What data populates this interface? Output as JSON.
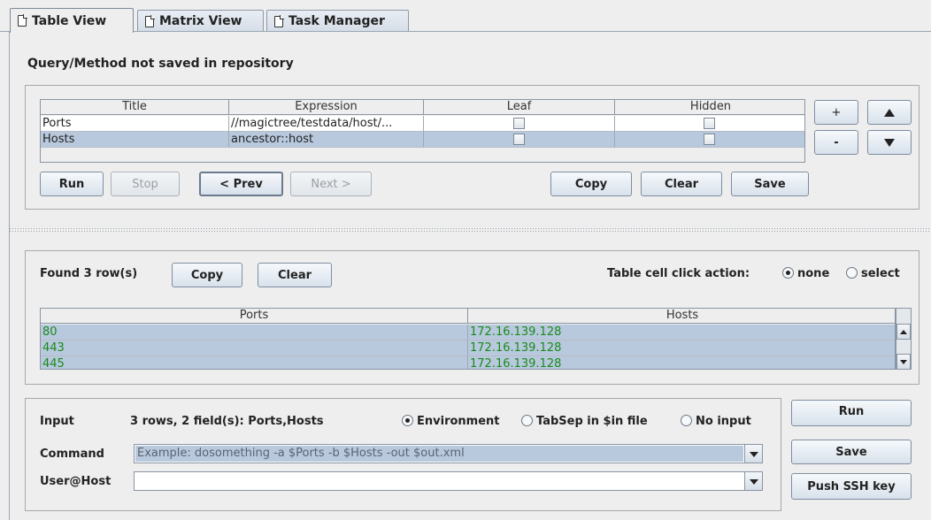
{
  "tabs": [
    {
      "label": "Table View",
      "active": true
    },
    {
      "label": "Matrix View",
      "active": false
    },
    {
      "label": "Task Manager",
      "active": false
    }
  ],
  "query": {
    "status": "Query/Method not saved in repository",
    "columns": [
      "Title",
      "Expression",
      "Leaf",
      "Hidden"
    ],
    "rows": [
      {
        "title": "Ports",
        "expression": "//magictree/testdata/host/...",
        "leaf": false,
        "hidden": false
      },
      {
        "title": "Hosts",
        "expression": "ancestor::host",
        "leaf": false,
        "hidden": false
      }
    ],
    "buttons": {
      "run": "Run",
      "stop": "Stop",
      "prev": "< Prev",
      "next": "Next >",
      "copy": "Copy",
      "clear": "Clear",
      "save": "Save",
      "add": "+",
      "remove": "-"
    }
  },
  "results": {
    "found": "Found 3 row(s)",
    "copy": "Copy",
    "clear": "Clear",
    "click_action_label": "Table cell click action:",
    "click_options": [
      "none",
      "select"
    ],
    "click_selected": "none",
    "columns": [
      "Ports",
      "Hosts"
    ],
    "rows": [
      [
        "80",
        "172.16.139.128"
      ],
      [
        "443",
        "172.16.139.128"
      ],
      [
        "445",
        "172.16.139.128"
      ]
    ],
    "row_text_color": "#1a8a1a",
    "row_bg_color": "#b8c9de"
  },
  "runner": {
    "input_label": "Input",
    "input_info": "3 rows, 2 field(s): Ports,Hosts",
    "input_options": [
      "Environment",
      "TabSep in $in file",
      "No input"
    ],
    "input_selected": "Environment",
    "command_label": "Command",
    "command_value": "Example: dosomething -a $Ports -b $Hosts -out $out.xml",
    "userhost_label": "User@Host",
    "userhost_value": "",
    "run": "Run",
    "save": "Save",
    "push_ssh": "Push SSH key"
  }
}
